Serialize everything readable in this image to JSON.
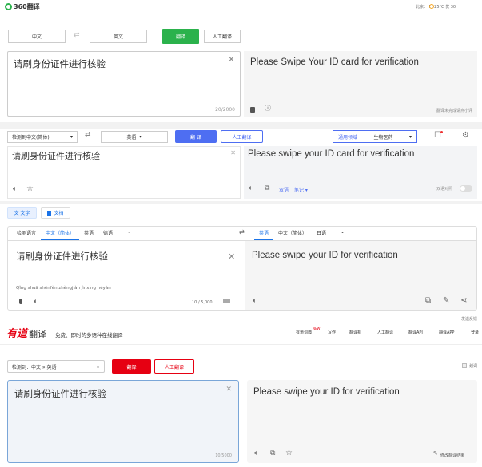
{
  "s1": {
    "logo": "360翻译",
    "status": "北京： 晴 25°C 优 30",
    "src_lang": "中文",
    "tgt_lang": "英文",
    "translate_btn": "翻译",
    "human_btn": "人工翻译",
    "input": "请刷身份证件进行核验",
    "count": "20/2000",
    "output": "Please Swipe Your ID card for verification",
    "feedback": "翻译未完成请点小评"
  },
  "s2": {
    "detect": "检测到中文(简体)",
    "target": "英语",
    "translate_btn": "翻 译",
    "human_btn": "人工翻译",
    "domain_label": "通用领域",
    "domain_value": "生物医药",
    "input": "请刷身份证件进行核验",
    "output": "Please swipe your ID card for verification",
    "link1": "双语",
    "link2": "笔记",
    "toggle_label": "双语对照",
    "tab_text": "文字",
    "tab_doc": "文档"
  },
  "s3": {
    "src_tabs": [
      "检测语言",
      "中文（简体）",
      "英语",
      "德语"
    ],
    "tgt_tabs": [
      "英语",
      "中文（简体）",
      "日语"
    ],
    "input": "请刷身份证件进行核验",
    "pinyin": "Qǐng shuā shēnfèn zhèngjiàn jìnxíng héyàn",
    "count": "10 / 5,000",
    "output": "Please swipe your ID for verification",
    "feedback": "发送反馈"
  },
  "s4": {
    "logo_red": "有道",
    "logo_black": "翻译",
    "slogan": "免费、即时的多语种在线翻译",
    "nav": [
      "有道词典",
      "写作",
      "翻译机",
      "人工翻译",
      "翻译API",
      "翻译APP",
      "登录"
    ],
    "detect": "检测到：中文 » 英语",
    "translate_btn": "翻译",
    "human_btn": "人工翻译",
    "checkbox_label": "划词",
    "input": "请刷身份证件进行核验",
    "count": "10/5000",
    "output": "Please swipe your ID for verification",
    "edit": "修改翻译结果"
  }
}
